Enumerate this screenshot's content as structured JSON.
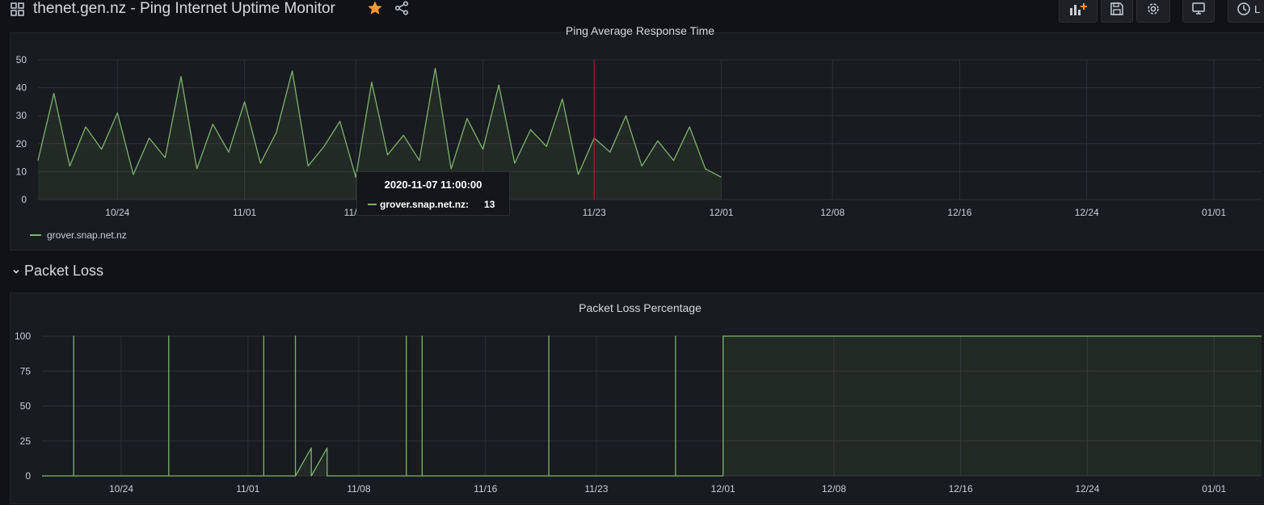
{
  "header": {
    "title": "thenet.gen.nz - Ping Internet Uptime Monitor",
    "time_picker_label": "L"
  },
  "colors": {
    "background": "#111217",
    "panel": "#181b1f",
    "series": "#7eb26d",
    "star": "#ff9830",
    "hover_line": "#c4162a"
  },
  "icons": {
    "dashboard": "dashboard-grid-icon",
    "star": "star-icon",
    "share": "share-icon",
    "add_panel": "add-panel-icon",
    "save": "save-icon",
    "settings": "gear-icon",
    "view_mode": "tv-monitor-icon",
    "time_picker": "clock-icon"
  },
  "ping_panel": {
    "title": "Ping Average Response Time",
    "legend_series": "grover.snap.net.nz"
  },
  "packet_row": {
    "title": "Packet Loss"
  },
  "packet_panel": {
    "title": "Packet Loss Percentage"
  },
  "tooltip": {
    "time": "2020-11-07 11:00:00",
    "series": "grover.snap.net.nz:",
    "value": "13"
  },
  "chart_data": [
    {
      "type": "line",
      "title": "Ping Average Response Time",
      "xlabel": "",
      "ylabel": "",
      "x_ticks": [
        "10/24",
        "11/01",
        "11/08",
        "11/16",
        "11/23",
        "12/01",
        "12/08",
        "12/16",
        "12/24",
        "01/01"
      ],
      "y_ticks": [
        0,
        10,
        20,
        30,
        40,
        50
      ],
      "ylim": [
        0,
        50
      ],
      "xlim": [
        "2020-10-19",
        "2021-01-04"
      ],
      "grid": true,
      "legend": "bottom-left",
      "hover_x": "2020-11-23",
      "series": [
        {
          "name": "grover.snap.net.nz",
          "x": [
            "2020-10-19",
            "2020-10-20",
            "2020-10-21",
            "2020-10-22",
            "2020-10-23",
            "2020-10-24",
            "2020-10-25",
            "2020-10-26",
            "2020-10-27",
            "2020-10-28",
            "2020-10-29",
            "2020-10-30",
            "2020-10-31",
            "2020-11-01",
            "2020-11-02",
            "2020-11-03",
            "2020-11-04",
            "2020-11-05",
            "2020-11-06",
            "2020-11-07",
            "2020-11-08",
            "2020-11-09",
            "2020-11-10",
            "2020-11-11",
            "2020-11-12",
            "2020-11-13",
            "2020-11-14",
            "2020-11-15",
            "2020-11-16",
            "2020-11-17",
            "2020-11-18",
            "2020-11-19",
            "2020-11-20",
            "2020-11-21",
            "2020-11-22",
            "2020-11-23",
            "2020-11-24",
            "2020-11-25",
            "2020-11-26",
            "2020-11-27",
            "2020-11-28",
            "2020-11-29",
            "2020-11-30",
            "2020-12-01"
          ],
          "values": [
            14,
            38,
            12,
            26,
            18,
            31,
            9,
            22,
            15,
            44,
            11,
            27,
            17,
            35,
            13,
            24,
            46,
            12,
            19,
            28,
            8,
            42,
            16,
            23,
            14,
            47,
            11,
            29,
            18,
            41,
            13,
            25,
            19,
            36,
            9,
            22,
            17,
            30,
            12,
            21,
            14,
            26,
            11,
            8
          ]
        }
      ]
    },
    {
      "type": "line",
      "title": "Packet Loss Percentage",
      "xlabel": "",
      "ylabel": "",
      "x_ticks": [
        "10/24",
        "11/01",
        "11/08",
        "11/16",
        "11/23",
        "12/01",
        "12/08",
        "12/16",
        "12/24",
        "01/01"
      ],
      "y_ticks": [
        0,
        25,
        50,
        75,
        100
      ],
      "ylim": [
        0,
        100
      ],
      "xlim": [
        "2020-10-19",
        "2021-01-04"
      ],
      "grid": true,
      "series": [
        {
          "name": "grover.snap.net.nz",
          "x": [
            "2020-10-19",
            "2020-10-21",
            "2020-10-21",
            "2020-10-21",
            "2020-10-27",
            "2020-10-27",
            "2020-10-27",
            "2020-11-02",
            "2020-11-02",
            "2020-11-02",
            "2020-11-04",
            "2020-11-04",
            "2020-11-04",
            "2020-11-05",
            "2020-11-05",
            "2020-11-06",
            "2020-11-06",
            "2020-11-11",
            "2020-11-11",
            "2020-11-11",
            "2020-11-12",
            "2020-11-12",
            "2020-11-12",
            "2020-11-20",
            "2020-11-20",
            "2020-11-20",
            "2020-11-28",
            "2020-11-28",
            "2020-11-28",
            "2020-12-01",
            "2020-12-01",
            "2021-01-04"
          ],
          "values": [
            0,
            0,
            100,
            0,
            0,
            100,
            0,
            0,
            100,
            0,
            0,
            100,
            0,
            20,
            0,
            20,
            0,
            0,
            100,
            0,
            0,
            100,
            0,
            0,
            100,
            0,
            0,
            100,
            0,
            0,
            100,
            100
          ]
        }
      ]
    }
  ]
}
